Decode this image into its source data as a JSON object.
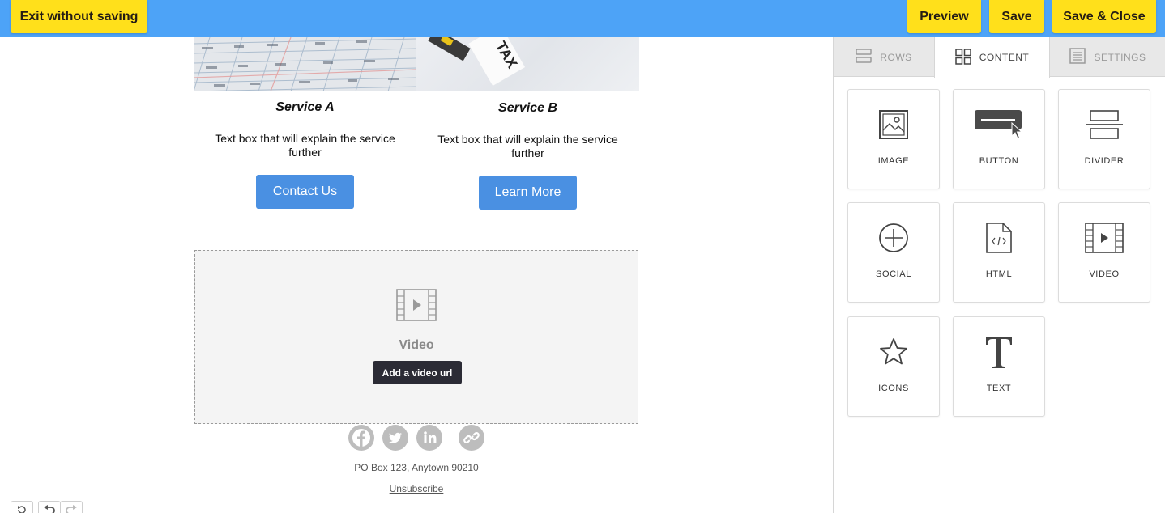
{
  "toolbar": {
    "exit_label": "Exit without saving",
    "preview_label": "Preview",
    "save_label": "Save",
    "save_close_label": "Save & Close"
  },
  "email": {
    "services": [
      {
        "title": "Service A",
        "text": "Text box that will explain the service further",
        "button": "Contact Us"
      },
      {
        "title": "Service B",
        "text": "Text box that will explain the service further",
        "button": "Learn More"
      }
    ],
    "image_b_text": "TAX",
    "video": {
      "label": "Video",
      "button": "Add a video url"
    },
    "address": "PO Box 123, Anytown 90210",
    "unsubscribe": "Unsubscribe"
  },
  "sidebar": {
    "tabs": [
      {
        "label": "ROWS",
        "icon": "rows-icon",
        "active": false
      },
      {
        "label": "CONTENT",
        "icon": "grid-icon",
        "active": true
      },
      {
        "label": "SETTINGS",
        "icon": "settings-doc-icon",
        "active": false
      }
    ],
    "tiles": [
      {
        "label": "IMAGE",
        "icon": "image-icon"
      },
      {
        "label": "BUTTON",
        "icon": "button-icon"
      },
      {
        "label": "DIVIDER",
        "icon": "divider-icon"
      },
      {
        "label": "SOCIAL",
        "icon": "plus-circle-icon"
      },
      {
        "label": "HTML",
        "icon": "html-file-icon"
      },
      {
        "label": "VIDEO",
        "icon": "film-icon"
      },
      {
        "label": "ICONS",
        "icon": "star-icon"
      },
      {
        "label": "TEXT",
        "icon": "text-t-icon"
      }
    ]
  },
  "colors": {
    "topbar": "#4da3f7",
    "accent_yellow": "#ffe01b",
    "email_button": "#4a90e2"
  }
}
